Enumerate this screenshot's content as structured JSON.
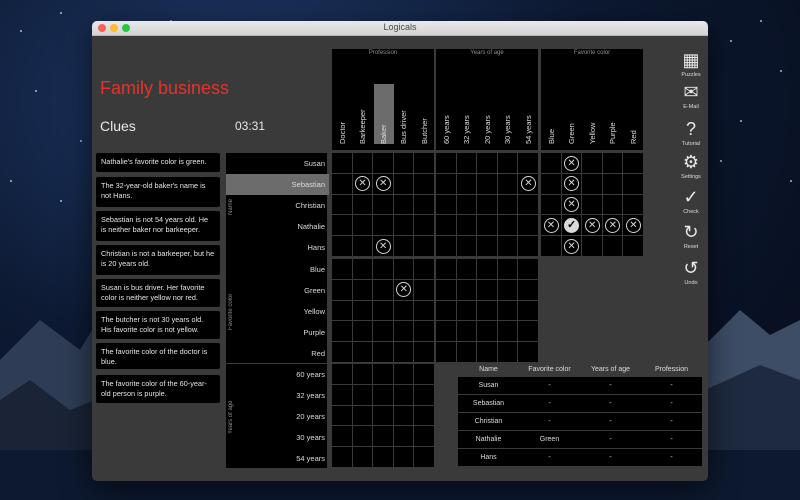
{
  "window": {
    "title": "Logicals"
  },
  "puzzle": {
    "title": "Family business",
    "clues_heading": "Clues",
    "timer": "03:31"
  },
  "clues": [
    "Nathalie's favorite color is green.",
    "The 32-year-old baker's name is not Hans.",
    "Sebastian is not 54 years old. He is neither baker nor barkeeper.",
    "Christian is not a barkeeper, but he is 20 years old.",
    "Susan is bus driver. Her favorite color is neither yellow nor red.",
    "The butcher is not 30 years old. His favorite color is not yellow.",
    "The favorite color of the doctor is blue.",
    "The favorite color of the 60-year-old person is purple."
  ],
  "column_groups": {
    "profession": {
      "label": "Profession",
      "items": [
        "Doctor",
        "Barkeeper",
        "Baker",
        "Bus driver",
        "Butcher"
      ]
    },
    "age": {
      "label": "Years of age",
      "items": [
        "60 years",
        "32 years",
        "20 years",
        "30 years",
        "54 years"
      ]
    },
    "color": {
      "label": "Favorite color",
      "items": [
        "Blue",
        "Green",
        "Yellow",
        "Purple",
        "Red"
      ]
    }
  },
  "row_groups": {
    "name": {
      "label": "Name",
      "items": [
        "Susan",
        "Sebastian",
        "Christian",
        "Nathalie",
        "Hans"
      ]
    },
    "color": {
      "label": "Favorite color",
      "items": [
        "Blue",
        "Green",
        "Yellow",
        "Purple",
        "Red"
      ]
    },
    "age": {
      "label": "Years of age",
      "items": [
        "60 years",
        "32 years",
        "20 years",
        "30 years",
        "54 years"
      ]
    }
  },
  "marks": {
    "name_profession": [
      {
        "r": 1,
        "c": 1,
        "m": "x"
      },
      {
        "r": 1,
        "c": 2,
        "m": "x"
      },
      {
        "r": 4,
        "c": 2,
        "m": "x"
      }
    ],
    "name_age": [
      {
        "r": 1,
        "c": 4,
        "m": "x"
      }
    ],
    "name_color": [
      {
        "r": 0,
        "c": 1,
        "m": "x"
      },
      {
        "r": 1,
        "c": 1,
        "m": "x"
      },
      {
        "r": 2,
        "c": 1,
        "m": "x"
      },
      {
        "r": 3,
        "c": 0,
        "m": "x"
      },
      {
        "r": 3,
        "c": 1,
        "m": "ok"
      },
      {
        "r": 3,
        "c": 2,
        "m": "x"
      },
      {
        "r": 3,
        "c": 3,
        "m": "x"
      },
      {
        "r": 3,
        "c": 4,
        "m": "x"
      },
      {
        "r": 4,
        "c": 1,
        "m": "x"
      }
    ],
    "color_profession": [
      {
        "r": 1,
        "c": 3,
        "m": "x"
      }
    ]
  },
  "tools": [
    {
      "icon": "puzzles-icon",
      "glyph": "▦",
      "label": "Puzzles"
    },
    {
      "icon": "email-icon",
      "glyph": "✉",
      "label": "E-Mail"
    },
    {
      "icon": "help-icon",
      "glyph": "?",
      "label": "Tutorial"
    },
    {
      "icon": "gear-icon",
      "glyph": "⚙",
      "label": "Settings"
    },
    {
      "icon": "check-icon",
      "glyph": "✓",
      "label": "Check"
    },
    {
      "icon": "reset-icon",
      "glyph": "↻",
      "label": "Reset"
    },
    {
      "icon": "undo-icon",
      "glyph": "↺",
      "label": "Undo"
    }
  ],
  "summary": {
    "headers": [
      "Name",
      "Favorite color",
      "Years of age",
      "Profession"
    ],
    "rows": [
      [
        "Susan",
        "-",
        "-",
        "-"
      ],
      [
        "Sebastian",
        "-",
        "-",
        "-"
      ],
      [
        "Christian",
        "-",
        "-",
        "-"
      ],
      [
        "Nathalie",
        "Green",
        "-",
        "-"
      ],
      [
        "Hans",
        "-",
        "-",
        "-"
      ]
    ]
  },
  "highlight": {
    "row": 1,
    "col": 2
  }
}
